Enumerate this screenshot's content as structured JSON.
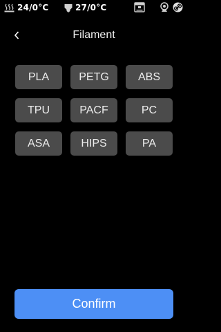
{
  "status_bar": {
    "bed_temp": "24/0°C",
    "nozzle_temp": "27/0°C",
    "icons": [
      "heated-bed-icon",
      "nozzle-icon",
      "printer-icon",
      "camera-icon",
      "link-icon"
    ]
  },
  "header": {
    "back_icon": "chevron-left-icon",
    "title": "Filament"
  },
  "filaments": [
    "PLA",
    "PETG",
    "ABS",
    "TPU",
    "PACF",
    "PC",
    "ASA",
    "HIPS",
    "PA"
  ],
  "confirm_label": "Confirm",
  "colors": {
    "background": "#000000",
    "chip": "#4b4b4b",
    "accent": "#4d8ff5",
    "text": "#ffffff"
  }
}
